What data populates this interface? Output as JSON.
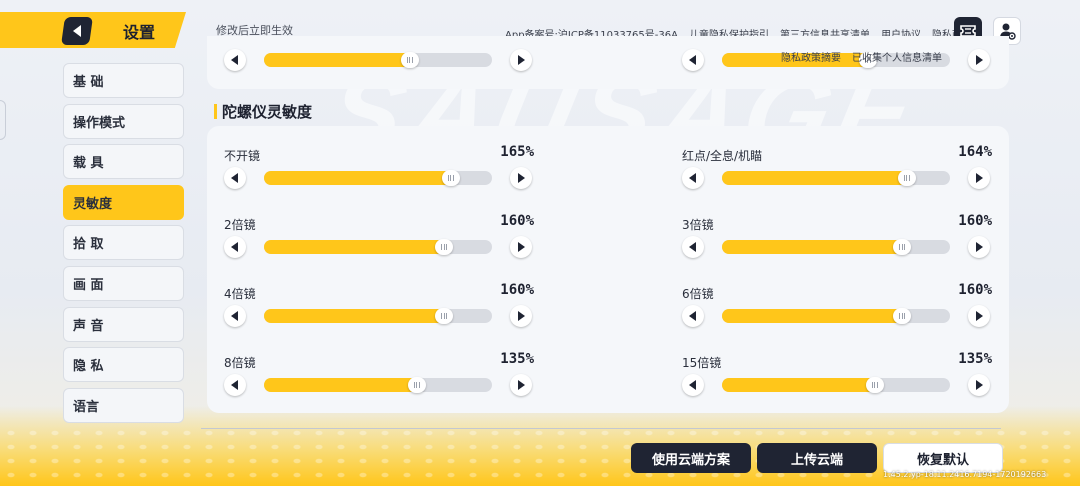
{
  "header": {
    "title": "设置",
    "notice": "修改后立即生效",
    "links": [
      "App备案号:沪ICP备11033765号-36A",
      "儿童隐私保护指引",
      "第三方信息共享清单",
      "用户协议",
      "隐私政策"
    ],
    "sub_links": [
      "隐私政策摘要",
      "已收集个人信息清单"
    ],
    "icons": [
      "back-arrow-icon",
      "ticket-icon",
      "user-settings-icon"
    ]
  },
  "sidebar": {
    "items": [
      {
        "label": "基 础",
        "active": false
      },
      {
        "label": "操作模式",
        "active": false
      },
      {
        "label": "载 具",
        "active": false
      },
      {
        "label": "灵敏度",
        "active": true
      },
      {
        "label": "拾 取",
        "active": false
      },
      {
        "label": "画 面",
        "active": false
      },
      {
        "label": "声 音",
        "active": false
      },
      {
        "label": "隐 私",
        "active": false
      },
      {
        "label": "语言",
        "active": false
      }
    ]
  },
  "top_sliders": [
    {
      "fill": 0.64
    },
    {
      "fill": 0.64
    }
  ],
  "section": {
    "title": "陀螺仪灵敏度",
    "sliders": [
      {
        "label": "不开镜",
        "value": "165%",
        "fill": 0.82
      },
      {
        "label": "红点/全息/机瞄",
        "value": "164%",
        "fill": 0.81
      },
      {
        "label": "2倍镜",
        "value": "160%",
        "fill": 0.79
      },
      {
        "label": "3倍镜",
        "value": "160%",
        "fill": 0.79
      },
      {
        "label": "4倍镜",
        "value": "160%",
        "fill": 0.79
      },
      {
        "label": "6倍镜",
        "value": "160%",
        "fill": 0.79
      },
      {
        "label": "8倍镜",
        "value": "135%",
        "fill": 0.67
      },
      {
        "label": "15倍镜",
        "value": "135%",
        "fill": 0.67
      }
    ]
  },
  "buttons": {
    "use_cloud": "使用云端方案",
    "upload_cloud": "上传云端",
    "reset": "恢复默认"
  },
  "build_id": "1.45.2.yp-18.11.2416.7194-1720192663",
  "colors": {
    "accent": "#ffc61a",
    "dark": "#1f2433",
    "panel": "#f5f7fa",
    "track": "#d8dbe1"
  }
}
